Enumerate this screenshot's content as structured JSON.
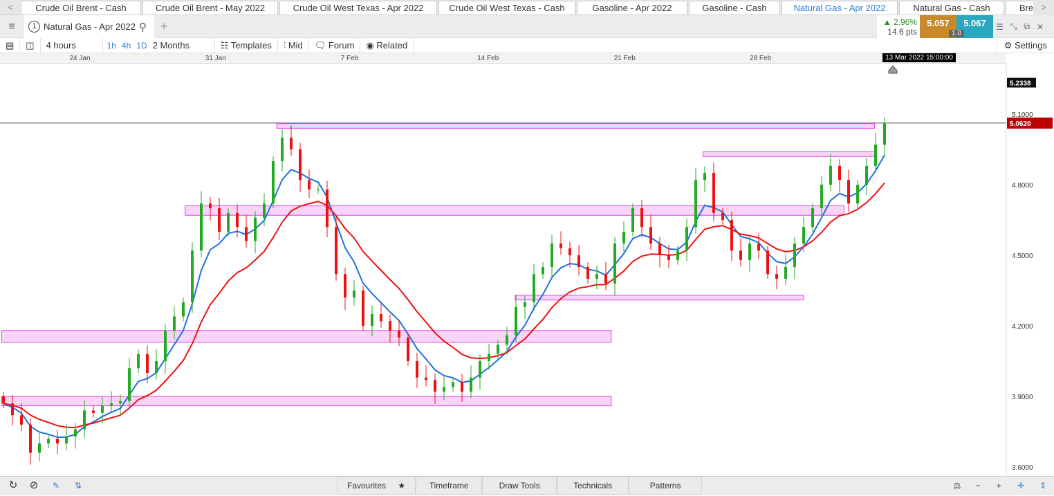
{
  "tabs": [
    "Crude Oil Brent - Cash",
    "Crude Oil Brent - May 2022",
    "Crude Oil West Texas - Apr 2022",
    "Crude Oil West Texas - Cash",
    "Gasoline - Apr 2022",
    "Gasoline - Cash",
    "Natural Gas - Apr 2022",
    "Natural Gas - Cash",
    "Bre"
  ],
  "active_tab": "Natural Gas - Apr 2022",
  "symbol": {
    "number": "1",
    "name": "Natural Gas - Apr 2022"
  },
  "quote": {
    "change_pct": "▲ 2.96%",
    "change_pts": "14.6 pts",
    "bid": "5.057",
    "ask": "5.067",
    "spread": "1.0",
    "bid_color": "#c8892a",
    "ask_color": "#29a8bf"
  },
  "toolbar": {
    "interval": "4 hours",
    "quick": [
      "1h",
      "4h",
      "1D"
    ],
    "range": "2 Months",
    "templates": "Templates",
    "mid": "Mid",
    "forum": "Forum",
    "related": "Related",
    "settings": "Settings"
  },
  "crosshair_label": "13 Mar 2022 15:00:00",
  "bottom": {
    "favourites": "Favourites",
    "timeframe": "Timeframe",
    "draw_tools": "Draw Tools",
    "technicals": "Technicals",
    "patterns": "Patterns"
  },
  "chart_data": {
    "type": "candlestick",
    "ylim": [
      3.55,
      5.3
    ],
    "y_ticks": [
      "5.1000",
      "4.8000",
      "4.5000",
      "4.2000",
      "3.9000",
      "3.6000"
    ],
    "x_ticks": [
      {
        "label": "24 Jan",
        "index": 8.5
      },
      {
        "label": "31 Jan",
        "index": 23.6
      },
      {
        "label": "7 Feb",
        "index": 38.5
      },
      {
        "label": "14 Feb",
        "index": 53.9
      },
      {
        "label": "21 Feb",
        "index": 69.1
      },
      {
        "label": "28 Feb",
        "index": 84.2
      }
    ],
    "closes": [
      3.87,
      3.82,
      3.78,
      3.66,
      3.7,
      3.72,
      3.7,
      3.73,
      3.76,
      3.84,
      3.83,
      3.86,
      3.87,
      3.88,
      4.02,
      4.08,
      4.0,
      4.05,
      4.18,
      4.24,
      4.3,
      4.52,
      4.72,
      4.7,
      4.6,
      4.68,
      4.62,
      4.56,
      4.66,
      4.72,
      4.9,
      5.0,
      4.95,
      4.82,
      4.78,
      4.78,
      4.62,
      4.42,
      4.32,
      4.35,
      4.2,
      4.25,
      4.22,
      4.18,
      4.15,
      4.05,
      3.98,
      3.97,
      3.92,
      3.94,
      3.96,
      3.92,
      3.98,
      4.05,
      4.08,
      4.12,
      4.16,
      4.28,
      4.3,
      4.42,
      4.45,
      4.55,
      4.53,
      4.5,
      4.45,
      4.4,
      4.42,
      4.38,
      4.55,
      4.6,
      4.7,
      4.62,
      4.55,
      4.5,
      4.48,
      4.52,
      4.62,
      4.82,
      4.85,
      4.68,
      4.65,
      4.52,
      4.48,
      4.55,
      4.52,
      4.42,
      4.4,
      4.45,
      4.55,
      4.62,
      4.7,
      4.8,
      4.88,
      4.82,
      4.72,
      4.8,
      4.88,
      4.97,
      5.06
    ],
    "last_price": "5.0620",
    "last_price_color": "#c00000",
    "marker_price": "5.2338",
    "up_color": "#22aa22",
    "down_color": "#ee1111",
    "moving_averages": [
      {
        "color": "#1e6fe0",
        "period": 5
      },
      {
        "color": "#ee1111",
        "period": 12
      }
    ],
    "zones": [
      {
        "from": 30.4,
        "to": 96.9,
        "low": 5.04,
        "high": 5.06
      },
      {
        "from": 77.8,
        "to": 96.9,
        "low": 4.92,
        "high": 4.94
      },
      {
        "from": 20.2,
        "to": 93.5,
        "low": 4.67,
        "high": 4.71
      },
      {
        "from": 56.9,
        "to": 89,
        "low": 4.31,
        "high": 4.33
      },
      {
        "from": -0.2,
        "to": 67.6,
        "low": 4.13,
        "high": 4.18
      },
      {
        "from": -0.2,
        "to": 67.6,
        "low": 3.86,
        "high": 3.9
      }
    ],
    "zone_color": "#e040e0"
  }
}
